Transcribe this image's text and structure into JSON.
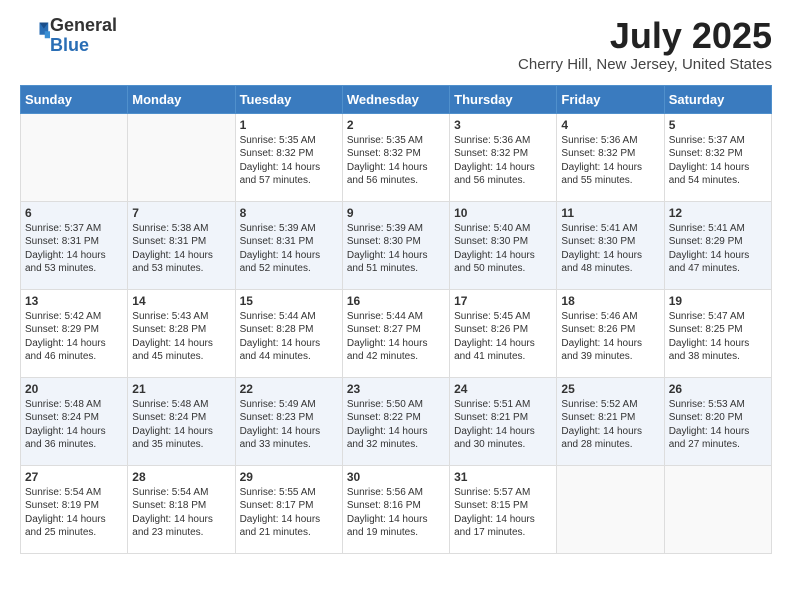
{
  "header": {
    "logo_general": "General",
    "logo_blue": "Blue",
    "month_title": "July 2025",
    "location": "Cherry Hill, New Jersey, United States"
  },
  "days_of_week": [
    "Sunday",
    "Monday",
    "Tuesday",
    "Wednesday",
    "Thursday",
    "Friday",
    "Saturday"
  ],
  "weeks": [
    [
      {
        "day": "",
        "info": ""
      },
      {
        "day": "",
        "info": ""
      },
      {
        "day": "1",
        "info": "Sunrise: 5:35 AM\nSunset: 8:32 PM\nDaylight: 14 hours and 57 minutes."
      },
      {
        "day": "2",
        "info": "Sunrise: 5:35 AM\nSunset: 8:32 PM\nDaylight: 14 hours and 56 minutes."
      },
      {
        "day": "3",
        "info": "Sunrise: 5:36 AM\nSunset: 8:32 PM\nDaylight: 14 hours and 56 minutes."
      },
      {
        "day": "4",
        "info": "Sunrise: 5:36 AM\nSunset: 8:32 PM\nDaylight: 14 hours and 55 minutes."
      },
      {
        "day": "5",
        "info": "Sunrise: 5:37 AM\nSunset: 8:32 PM\nDaylight: 14 hours and 54 minutes."
      }
    ],
    [
      {
        "day": "6",
        "info": "Sunrise: 5:37 AM\nSunset: 8:31 PM\nDaylight: 14 hours and 53 minutes."
      },
      {
        "day": "7",
        "info": "Sunrise: 5:38 AM\nSunset: 8:31 PM\nDaylight: 14 hours and 53 minutes."
      },
      {
        "day": "8",
        "info": "Sunrise: 5:39 AM\nSunset: 8:31 PM\nDaylight: 14 hours and 52 minutes."
      },
      {
        "day": "9",
        "info": "Sunrise: 5:39 AM\nSunset: 8:30 PM\nDaylight: 14 hours and 51 minutes."
      },
      {
        "day": "10",
        "info": "Sunrise: 5:40 AM\nSunset: 8:30 PM\nDaylight: 14 hours and 50 minutes."
      },
      {
        "day": "11",
        "info": "Sunrise: 5:41 AM\nSunset: 8:30 PM\nDaylight: 14 hours and 48 minutes."
      },
      {
        "day": "12",
        "info": "Sunrise: 5:41 AM\nSunset: 8:29 PM\nDaylight: 14 hours and 47 minutes."
      }
    ],
    [
      {
        "day": "13",
        "info": "Sunrise: 5:42 AM\nSunset: 8:29 PM\nDaylight: 14 hours and 46 minutes."
      },
      {
        "day": "14",
        "info": "Sunrise: 5:43 AM\nSunset: 8:28 PM\nDaylight: 14 hours and 45 minutes."
      },
      {
        "day": "15",
        "info": "Sunrise: 5:44 AM\nSunset: 8:28 PM\nDaylight: 14 hours and 44 minutes."
      },
      {
        "day": "16",
        "info": "Sunrise: 5:44 AM\nSunset: 8:27 PM\nDaylight: 14 hours and 42 minutes."
      },
      {
        "day": "17",
        "info": "Sunrise: 5:45 AM\nSunset: 8:26 PM\nDaylight: 14 hours and 41 minutes."
      },
      {
        "day": "18",
        "info": "Sunrise: 5:46 AM\nSunset: 8:26 PM\nDaylight: 14 hours and 39 minutes."
      },
      {
        "day": "19",
        "info": "Sunrise: 5:47 AM\nSunset: 8:25 PM\nDaylight: 14 hours and 38 minutes."
      }
    ],
    [
      {
        "day": "20",
        "info": "Sunrise: 5:48 AM\nSunset: 8:24 PM\nDaylight: 14 hours and 36 minutes."
      },
      {
        "day": "21",
        "info": "Sunrise: 5:48 AM\nSunset: 8:24 PM\nDaylight: 14 hours and 35 minutes."
      },
      {
        "day": "22",
        "info": "Sunrise: 5:49 AM\nSunset: 8:23 PM\nDaylight: 14 hours and 33 minutes."
      },
      {
        "day": "23",
        "info": "Sunrise: 5:50 AM\nSunset: 8:22 PM\nDaylight: 14 hours and 32 minutes."
      },
      {
        "day": "24",
        "info": "Sunrise: 5:51 AM\nSunset: 8:21 PM\nDaylight: 14 hours and 30 minutes."
      },
      {
        "day": "25",
        "info": "Sunrise: 5:52 AM\nSunset: 8:21 PM\nDaylight: 14 hours and 28 minutes."
      },
      {
        "day": "26",
        "info": "Sunrise: 5:53 AM\nSunset: 8:20 PM\nDaylight: 14 hours and 27 minutes."
      }
    ],
    [
      {
        "day": "27",
        "info": "Sunrise: 5:54 AM\nSunset: 8:19 PM\nDaylight: 14 hours and 25 minutes."
      },
      {
        "day": "28",
        "info": "Sunrise: 5:54 AM\nSunset: 8:18 PM\nDaylight: 14 hours and 23 minutes."
      },
      {
        "day": "29",
        "info": "Sunrise: 5:55 AM\nSunset: 8:17 PM\nDaylight: 14 hours and 21 minutes."
      },
      {
        "day": "30",
        "info": "Sunrise: 5:56 AM\nSunset: 8:16 PM\nDaylight: 14 hours and 19 minutes."
      },
      {
        "day": "31",
        "info": "Sunrise: 5:57 AM\nSunset: 8:15 PM\nDaylight: 14 hours and 17 minutes."
      },
      {
        "day": "",
        "info": ""
      },
      {
        "day": "",
        "info": ""
      }
    ]
  ]
}
